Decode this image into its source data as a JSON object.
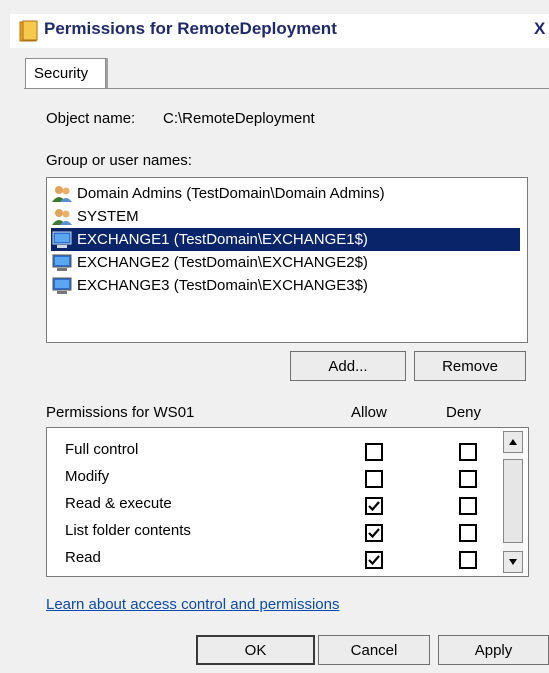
{
  "window": {
    "title": "Permissions for RemoteDeployment",
    "close_glyph": "X"
  },
  "tabs": [
    {
      "label": "Security"
    }
  ],
  "object": {
    "label": "Object name:",
    "value": "C:\\RemoteDeployment"
  },
  "users": {
    "label": "Group or user names:",
    "items": [
      {
        "label": "Domain Admins (TestDomain\\Domain Admins)",
        "icon": "group-icon",
        "selected": false
      },
      {
        "label": "SYSTEM",
        "icon": "group-icon",
        "selected": false
      },
      {
        "label": "EXCHANGE1 (TestDomain\\EXCHANGE1$)",
        "icon": "computer-icon",
        "selected": true
      },
      {
        "label": "EXCHANGE2 (TestDomain\\EXCHANGE2$)",
        "icon": "computer-icon",
        "selected": false
      },
      {
        "label": "EXCHANGE3 (TestDomain\\EXCHANGE3$)",
        "icon": "computer-icon",
        "selected": false
      }
    ],
    "add_label": "Add...",
    "remove_label": "Remove"
  },
  "permissions": {
    "label": "Permissions for WS01",
    "allow_header": "Allow",
    "deny_header": "Deny",
    "rows": [
      {
        "label": "Full control",
        "allow": false,
        "deny": false
      },
      {
        "label": "Modify",
        "allow": false,
        "deny": false
      },
      {
        "label": "Read & execute",
        "allow": true,
        "deny": false
      },
      {
        "label": "List folder contents",
        "allow": true,
        "deny": false
      },
      {
        "label": "Read",
        "allow": true,
        "deny": false
      }
    ]
  },
  "link": "Learn about access control and permissions",
  "footer": {
    "ok_label": "OK",
    "cancel_label": "Cancel",
    "apply_label": "Apply"
  },
  "colors": {
    "selection": "#0a246a",
    "title_text": "#1f2a6a",
    "link": "#0b4aa8"
  }
}
